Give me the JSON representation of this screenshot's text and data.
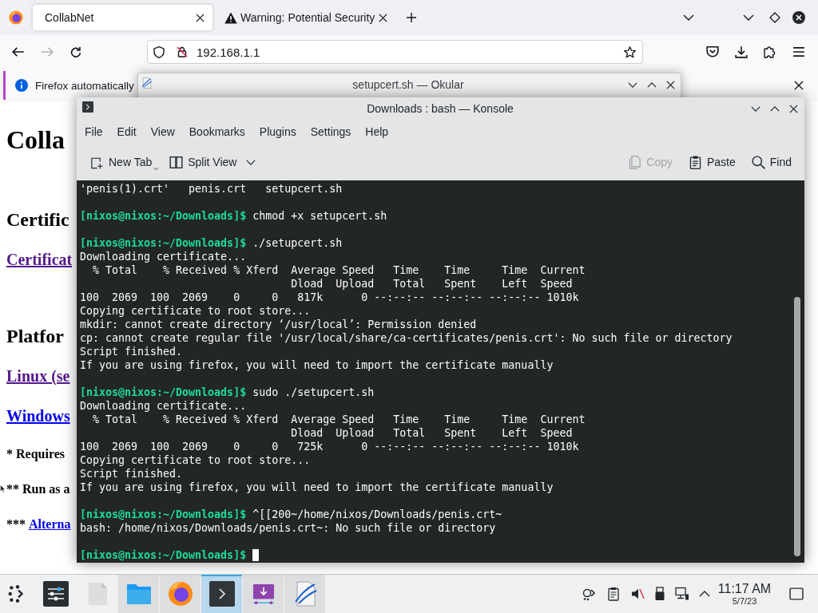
{
  "browser": {
    "tabs": [
      {
        "title": "CollabNet",
        "kind": "plain",
        "selected": true
      },
      {
        "title": "Warning: Potential Security",
        "kind": "warning",
        "selected": false
      }
    ],
    "nav_buttons": [
      {
        "kind": "back",
        "disabled": false
      },
      {
        "kind": "forward",
        "disabled": true
      },
      {
        "kind": "reload",
        "disabled": false
      }
    ],
    "address_bar": {
      "value": "192.168.1.1"
    },
    "notification": {
      "text": "Firefox automatically"
    },
    "page": {
      "items": [
        {
          "kind": "h1",
          "text": "Colla"
        },
        {
          "kind": "h2",
          "text": "Certific"
        },
        {
          "kind": "link",
          "text": "Certificat",
          "visited": true
        },
        {
          "kind": "h2",
          "text": "Platfor"
        },
        {
          "kind": "link",
          "text": "Linux (se",
          "visited": true
        },
        {
          "kind": "link",
          "text": "Windows",
          "visited": false
        },
        {
          "kind": "note",
          "text": "* Requires"
        },
        {
          "kind": "note",
          "text": "** Run as a"
        },
        {
          "kind": "note",
          "text": "***",
          "link": {
            "text": "Alterna",
            "visited": false
          }
        }
      ]
    }
  },
  "okular_window": {
    "title": "setupcert.sh — Okular"
  },
  "konsole_window": {
    "title": "Downloads : bash — Konsole",
    "menu": [
      "File",
      "Edit",
      "View",
      "Bookmarks",
      "Plugins",
      "Settings",
      "Help"
    ],
    "toolbar_left": [
      {
        "kind": "new-tab",
        "label": "New Tab",
        "disabled": false
      },
      {
        "kind": "split-view",
        "label": "Split View",
        "disabled": false
      }
    ],
    "toolbar_right": [
      {
        "kind": "copy",
        "label": "Copy",
        "disabled": true
      },
      {
        "kind": "paste",
        "label": "Paste",
        "disabled": false
      },
      {
        "kind": "find",
        "label": "Find",
        "disabled": false
      }
    ],
    "terminal": {
      "blocks": [
        {
          "lines": [
            {
              "kind": "output",
              "text": "'penis(1).crt'   penis.crt   setupcert.sh"
            }
          ]
        },
        {
          "lines": [
            {
              "kind": "prompt",
              "prompt": "[nixos@nixos:~/Downloads]$",
              "command": "chmod +x setupcert.sh",
              "cursor": false
            }
          ]
        },
        {
          "lines": [
            {
              "kind": "prompt",
              "prompt": "[nixos@nixos:~/Downloads]$",
              "command": "./setupcert.sh",
              "cursor": false
            },
            {
              "kind": "output",
              "text": "Downloading certificate..."
            },
            {
              "kind": "output",
              "text": "  % Total    % Received % Xferd  Average Speed   Time    Time     Time  Current"
            },
            {
              "kind": "output",
              "text": "                                 Dload  Upload   Total   Spent    Left  Speed"
            },
            {
              "kind": "output",
              "text": "100  2069  100  2069    0     0   817k      0 --:--:-- --:--:-- --:--:-- 1010k"
            },
            {
              "kind": "output",
              "text": "Copying certificate to root store..."
            },
            {
              "kind": "output",
              "text": "mkdir: cannot create directory ‘/usr/local’: Permission denied"
            },
            {
              "kind": "output",
              "text": "cp: cannot create regular file '/usr/local/share/ca-certificates/penis.crt': No such file or directory"
            },
            {
              "kind": "output",
              "text": "Script finished."
            },
            {
              "kind": "output",
              "text": "If you are using firefox, you will need to import the certificate manually"
            }
          ]
        },
        {
          "lines": [
            {
              "kind": "prompt",
              "prompt": "[nixos@nixos:~/Downloads]$",
              "command": "sudo ./setupcert.sh",
              "cursor": false
            },
            {
              "kind": "output",
              "text": "Downloading certificate..."
            },
            {
              "kind": "output",
              "text": "  % Total    % Received % Xferd  Average Speed   Time    Time     Time  Current"
            },
            {
              "kind": "output",
              "text": "                                 Dload  Upload   Total   Spent    Left  Speed"
            },
            {
              "kind": "output",
              "text": "100  2069  100  2069    0     0   725k      0 --:--:-- --:--:-- --:--:-- 1010k"
            },
            {
              "kind": "output",
              "text": "Copying certificate to root store..."
            },
            {
              "kind": "output",
              "text": "Script finished."
            },
            {
              "kind": "output",
              "text": "If you are using firefox, you will need to import the certificate manually"
            }
          ]
        },
        {
          "lines": [
            {
              "kind": "prompt",
              "prompt": "[nixos@nixos:~/Downloads]$",
              "command": "^[[200~/home/nixos/Downloads/penis.crt~",
              "cursor": false
            },
            {
              "kind": "output",
              "text": "bash: /home/nixos/Downloads/penis.crt~: No such file or directory"
            }
          ]
        },
        {
          "lines": [
            {
              "kind": "prompt",
              "prompt": "[nixos@nixos:~/Downloads]$",
              "cursor": true
            }
          ]
        }
      ]
    }
  },
  "taskbar": {
    "tasks": [
      {
        "kind": "settings",
        "running": false,
        "selected": false
      },
      {
        "kind": "document",
        "running": false,
        "selected": false
      },
      {
        "kind": "files",
        "running": true,
        "selected": false
      },
      {
        "kind": "browser",
        "running": true,
        "selected": false
      },
      {
        "kind": "terminal",
        "running": true,
        "selected": true
      },
      {
        "kind": "downloads",
        "running": true,
        "selected": false
      },
      {
        "kind": "viewer",
        "running": true,
        "selected": false
      }
    ],
    "volume": {
      "muted": true
    },
    "clock": {
      "time": "11:17 AM",
      "date": "5/7/23"
    }
  }
}
